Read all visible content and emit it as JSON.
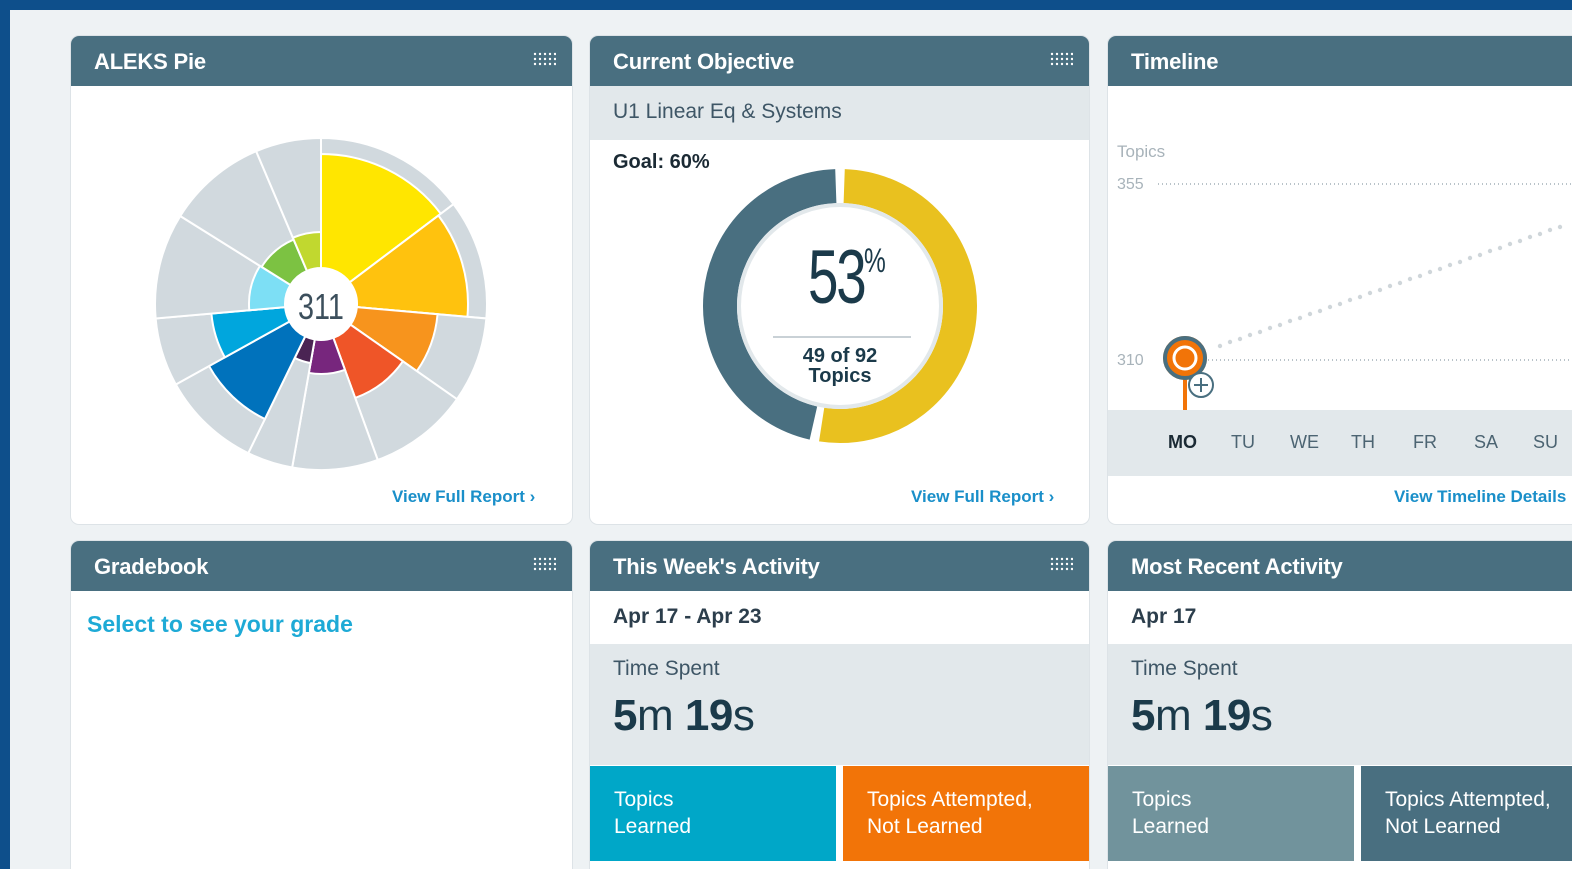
{
  "colors": {
    "header": "#496f80",
    "link": "#1a8fc9",
    "accent_yellow": "#e9c11f",
    "accent_slate": "#496f80",
    "orange": "#f27408",
    "cyan": "#00a7c8"
  },
  "pie": {
    "title": "ALEKS Pie",
    "center_value": "311",
    "link": "View Full Report ›"
  },
  "objective": {
    "title": "Current Objective",
    "name": "U1 Linear Eq & Systems",
    "goal": "Goal: 60%",
    "percent": "53",
    "percent_sign": "%",
    "progress_fraction": 0.53,
    "topics_line1": "49 of 92",
    "topics_line2": "Topics",
    "link": "View Full Report ›"
  },
  "timeline": {
    "title": "Timeline",
    "axis_label": "Topics",
    "tick_high": "355",
    "tick_low": "310",
    "days": [
      "MO",
      "TU",
      "WE",
      "TH",
      "FR",
      "SA",
      "SU"
    ],
    "link": "View Timeline Details"
  },
  "gradebook": {
    "title": "Gradebook",
    "prompt": "Select to see your grade"
  },
  "week": {
    "title": "This Week's Activity",
    "dates": "Apr 17 - Apr 23",
    "time_label": "Time Spent",
    "minutes": "5",
    "m": "m ",
    "seconds": "19",
    "s": "s",
    "tile_learned_1": "Topics",
    "tile_learned_2": "Learned",
    "tile_attempted_1": "Topics Attempted,",
    "tile_attempted_2": "Not Learned"
  },
  "recent": {
    "title": "Most Recent Activity",
    "date": "Apr 17",
    "time_label": "Time Spent",
    "minutes": "5",
    "m": "m ",
    "seconds": "19",
    "s": "s",
    "tile_learned_1": "Topics",
    "tile_learned_2": "Learned",
    "tile_attempted_1": "Topics Attempted,",
    "tile_attempted_2": "Not Learned"
  }
}
